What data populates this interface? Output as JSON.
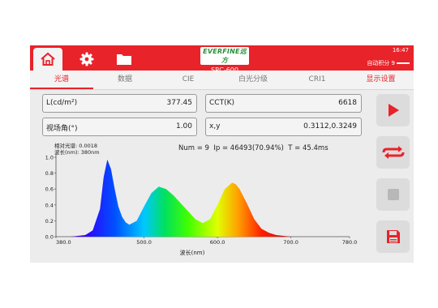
{
  "header": {
    "brand_logo": "EVERFINE远方",
    "model": "SRC-600",
    "time": "16:47",
    "auto_integration": "自动积分 9"
  },
  "tabs": [
    {
      "label": "光谱",
      "active": true
    },
    {
      "label": "数据"
    },
    {
      "label": "CIE"
    },
    {
      "label": "白光分级"
    },
    {
      "label": "CRI1"
    },
    {
      "label": "显示设置"
    }
  ],
  "fields": {
    "luminance": {
      "label": "L(cd/m²)",
      "value": "377.45"
    },
    "cct": {
      "label": "CCT(K)",
      "value": "6618"
    },
    "view_angle": {
      "label": "视场角(°)",
      "value": "1.00"
    },
    "xy": {
      "label": "x,y",
      "value": "0.3112,0.3249"
    }
  },
  "stats": {
    "text": "Num = 9  Ip = 46493(70.94%)  T = 45.4ms"
  },
  "chart_data": {
    "type": "line",
    "xlabel": "波长(nm)",
    "xlim": [
      380,
      780
    ],
    "ylim": [
      0,
      1.0
    ],
    "x_ticks": [
      380,
      500,
      600,
      700,
      780
    ],
    "x_tick_labels": [
      "380.0",
      "500.0",
      "600.0",
      "700.0",
      "780.0"
    ],
    "y_ticks": [
      0,
      0.2,
      0.4,
      0.6,
      0.8,
      1.0
    ],
    "y_tick_labels": [
      "0.0",
      "0.2",
      "0.4",
      "0.6",
      "0.8",
      "1.0"
    ],
    "annotations": [
      "相对光谱: 0.0018",
      "波长(nm): 380nm"
    ],
    "series": [
      {
        "x": [
          380,
          400,
          420,
          430,
          440,
          445,
          450,
          455,
          460,
          465,
          470,
          475,
          480,
          490,
          500,
          510,
          520,
          530,
          540,
          550,
          560,
          570,
          580,
          590,
          600,
          610,
          620,
          625,
          630,
          640,
          650,
          660,
          670,
          680,
          700,
          720,
          740,
          760,
          780
        ],
        "y": [
          0.0,
          0.0,
          0.02,
          0.08,
          0.35,
          0.75,
          0.97,
          0.85,
          0.6,
          0.38,
          0.25,
          0.18,
          0.15,
          0.2,
          0.38,
          0.55,
          0.63,
          0.6,
          0.52,
          0.42,
          0.32,
          0.22,
          0.17,
          0.22,
          0.4,
          0.6,
          0.68,
          0.66,
          0.6,
          0.42,
          0.22,
          0.1,
          0.05,
          0.02,
          0.0,
          0.0,
          0.0,
          0.0,
          0.0
        ]
      }
    ]
  },
  "side_buttons": [
    "play-icon",
    "loop-icon",
    "stop-icon",
    "save-icon"
  ]
}
